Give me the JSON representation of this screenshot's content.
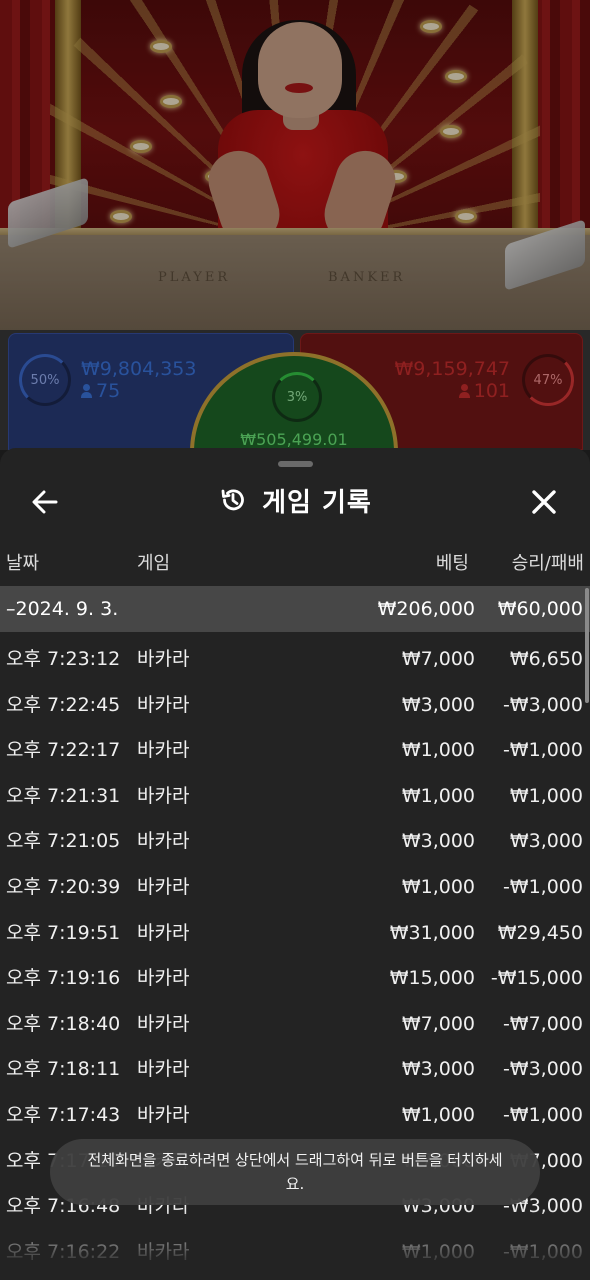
{
  "table": {
    "label_player": "PLAYER",
    "label_banker": "BANKER"
  },
  "betting": {
    "player": {
      "percent": "50%",
      "amount": "₩9,804,353",
      "players": "75",
      "color": "#3d79e6"
    },
    "banker": {
      "percent": "47%",
      "amount": "₩9,159,747",
      "players": "101",
      "color": "#d33030"
    },
    "tie": {
      "percent": "3%",
      "amount": "₩505,499.01",
      "color": "#6ff07c"
    }
  },
  "history": {
    "title": "게임 기록",
    "icons": {
      "back": "arrow-left-icon",
      "title": "history-icon",
      "close": "close-icon"
    },
    "columns": {
      "date": "날짜",
      "game": "게임",
      "bet": "베팅",
      "result": "승리/패배"
    },
    "date_group": {
      "date": "–2024. 9. 3.",
      "bet": "₩206,000",
      "result": "₩60,000"
    },
    "rows": [
      {
        "time": "오후 7:23:12",
        "game": "바카라",
        "bet": "₩7,000",
        "result": "₩6,650"
      },
      {
        "time": "오후 7:22:45",
        "game": "바카라",
        "bet": "₩3,000",
        "result": "-₩3,000"
      },
      {
        "time": "오후 7:22:17",
        "game": "바카라",
        "bet": "₩1,000",
        "result": "-₩1,000"
      },
      {
        "time": "오후 7:21:31",
        "game": "바카라",
        "bet": "₩1,000",
        "result": "₩1,000"
      },
      {
        "time": "오후 7:21:05",
        "game": "바카라",
        "bet": "₩3,000",
        "result": "₩3,000"
      },
      {
        "time": "오후 7:20:39",
        "game": "바카라",
        "bet": "₩1,000",
        "result": "-₩1,000"
      },
      {
        "time": "오후 7:19:51",
        "game": "바카라",
        "bet": "₩31,000",
        "result": "₩29,450"
      },
      {
        "time": "오후 7:19:16",
        "game": "바카라",
        "bet": "₩15,000",
        "result": "-₩15,000"
      },
      {
        "time": "오후 7:18:40",
        "game": "바카라",
        "bet": "₩7,000",
        "result": "-₩7,000"
      },
      {
        "time": "오후 7:18:11",
        "game": "바카라",
        "bet": "₩3,000",
        "result": "-₩3,000"
      },
      {
        "time": "오후 7:17:43",
        "game": "바카라",
        "bet": "₩1,000",
        "result": "-₩1,000"
      },
      {
        "time": "오후 7:17:15",
        "game": "바카라",
        "bet": "₩7,000",
        "result": "₩7,000"
      },
      {
        "time": "오후 7:16:48",
        "game": "바카라",
        "bet": "₩3,000",
        "result": "-₩3,000"
      },
      {
        "time": "오후 7:16:22",
        "game": "바카라",
        "bet": "₩1,000",
        "result": "-₩1,000"
      }
    ]
  },
  "toast": {
    "text": "전체화면을 종료하려면 상단에서 드래그하여 뒤로 버튼을 터치하세요."
  }
}
